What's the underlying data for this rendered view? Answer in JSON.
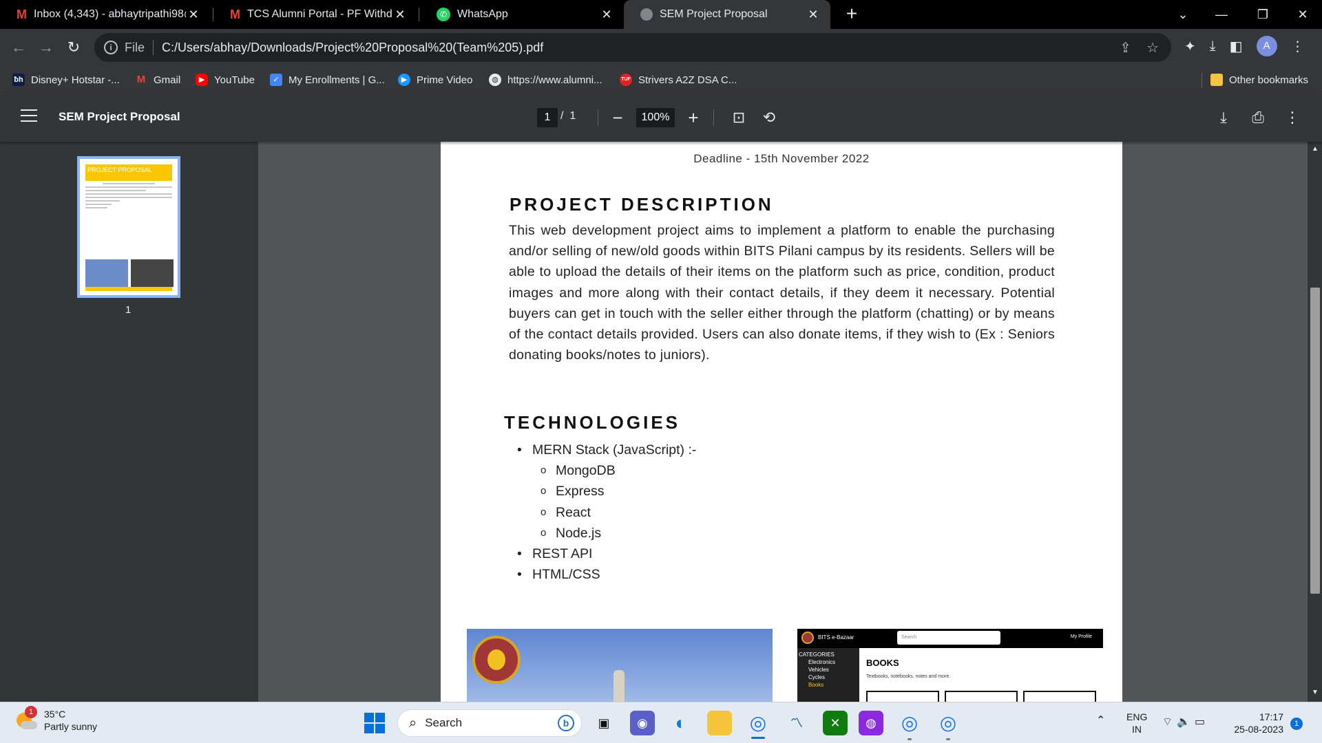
{
  "tabs": [
    {
      "title": "Inbox (4,343) - abhaytripathi98@",
      "icon": "gmail-icon"
    },
    {
      "title": "TCS Alumni Portal - PF Withdraw",
      "icon": "gmail-icon"
    },
    {
      "title": "WhatsApp",
      "icon": "whatsapp-icon"
    },
    {
      "title": "SEM Project Proposal",
      "icon": "globe-icon",
      "active": true
    }
  ],
  "address_bar": {
    "scheme": "File",
    "url": "C:/Users/abhay/Downloads/Project%20Proposal%20(Team%205).pdf",
    "profile_initial": "A"
  },
  "bookmarks": [
    {
      "label": "Disney+ Hotstar -...",
      "icon": "hotstar-icon"
    },
    {
      "label": "Gmail",
      "icon": "gmail-icon"
    },
    {
      "label": "YouTube",
      "icon": "youtube-icon"
    },
    {
      "label": "My Enrollments | G...",
      "icon": "enrollments-icon"
    },
    {
      "label": "Prime Video",
      "icon": "prime-video-icon"
    },
    {
      "label": "https://www.alumni...",
      "icon": "globe-icon"
    },
    {
      "label": "Strivers A2Z DSA C...",
      "icon": "tuf-icon"
    }
  ],
  "other_bookmarks": "Other bookmarks",
  "pdf_viewer": {
    "title": "SEM Project Proposal",
    "current_page": "1",
    "page_separator": "/",
    "total_pages": "1",
    "zoom": "100%",
    "thumbnail_label": "1",
    "thumbnail_header": "PROJECT PROPOSAL"
  },
  "document": {
    "deadline": "Deadline - 15th November 2022",
    "description_heading": "PROJECT DESCRIPTION",
    "description_text": "This web development project aims to implement a platform to enable the purchasing and/or selling of new/old goods within BITS Pilani campus by its residents. Sellers will be able to upload the details of their items on the platform such as price, condition, product images and more along with their contact details, if they deem it necessary. Potential buyers can get in touch with the seller either through the platform (chatting) or by means of the contact details provided. Users can also donate items, if they wish to (Ex : Seniors donating books/notes to juniors).",
    "technologies_heading": "TECHNOLOGIES",
    "technologies": [
      {
        "label": "MERN Stack (JavaScript) :-",
        "level": 1
      },
      {
        "label": "MongoDB",
        "level": 2
      },
      {
        "label": "Express",
        "level": 2
      },
      {
        "label": "React",
        "level": 2
      },
      {
        "label": "Node.js",
        "level": 2
      },
      {
        "label": "REST API",
        "level": 1
      },
      {
        "label": "HTML/CSS",
        "level": 1
      }
    ],
    "app_screenshot": {
      "brand": "BITS e-Bazaar",
      "search_placeholder": "Search",
      "profile": "My Profile",
      "categories_heading": "CATEGORIES",
      "categories": [
        "Electronics",
        "Vehicles",
        "Cycles",
        "Books"
      ],
      "page_heading": "BOOKS",
      "page_subtitle": "Textbooks, notebooks, notes and more."
    }
  },
  "taskbar": {
    "weather_temp": "35°C",
    "weather_desc": "Partly sunny",
    "weather_badge": "1",
    "search_label": "Search",
    "language_top": "ENG",
    "language_bottom": "IN",
    "time": "17:17",
    "date": "25-08-2023",
    "notification_count": "1"
  }
}
